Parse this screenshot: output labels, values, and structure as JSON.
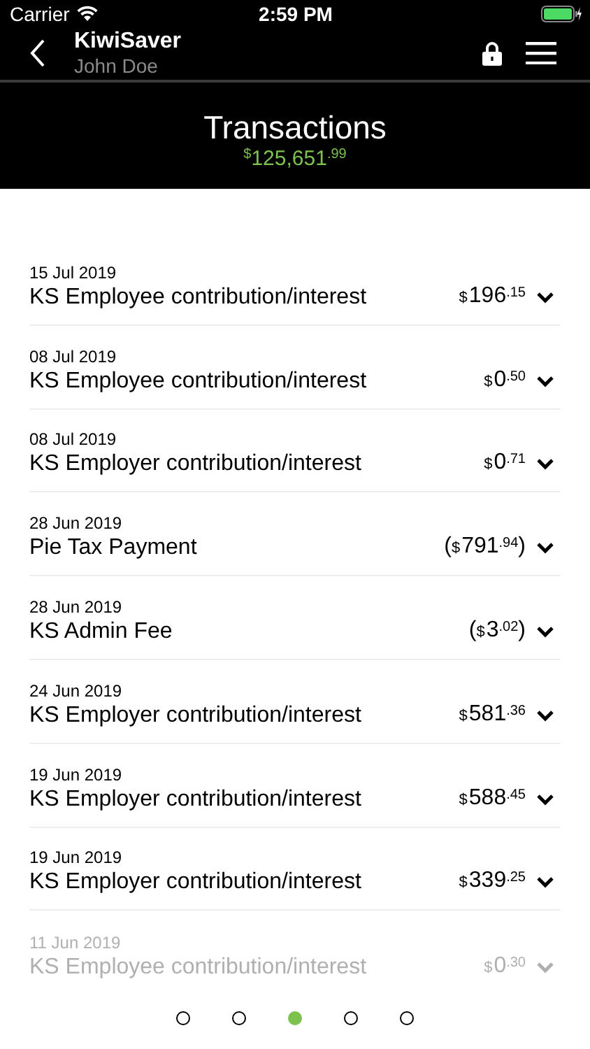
{
  "status_bar": {
    "carrier": "Carrier",
    "time": "2:59 PM"
  },
  "nav": {
    "title": "KiwiSaver",
    "subtitle": "John Doe"
  },
  "header": {
    "title": "Transactions",
    "balance": {
      "currency": "$",
      "whole": "125,651",
      "cents": ".99"
    }
  },
  "transactions": [
    {
      "date": "15 Jul 2019",
      "description": "KS Employee contribution/interest",
      "amount": {
        "currency": "$",
        "whole": "196",
        "cents": ".15"
      },
      "faded": false
    },
    {
      "date": "08 Jul 2019",
      "description": "KS Employee contribution/interest",
      "amount": {
        "currency": "$",
        "whole": "0",
        "cents": ".50"
      },
      "faded": false
    },
    {
      "date": "08 Jul 2019",
      "description": "KS Employer contribution/interest",
      "amount": {
        "currency": "$",
        "whole": "0",
        "cents": ".71"
      },
      "faded": false
    },
    {
      "date": "28 Jun 2019",
      "description": "Pie Tax Payment",
      "amount": {
        "open": "(",
        "currency": "$",
        "whole": "791",
        "cents": ".94",
        "close": ")"
      },
      "faded": false
    },
    {
      "date": "28 Jun 2019",
      "description": "KS Admin Fee",
      "amount": {
        "open": "(",
        "currency": "$",
        "whole": "3",
        "cents": ".02",
        "close": ")"
      },
      "faded": false
    },
    {
      "date": "24 Jun 2019",
      "description": "KS Employer contribution/interest",
      "amount": {
        "currency": "$",
        "whole": "581",
        "cents": ".36"
      },
      "faded": false
    },
    {
      "date": "19 Jun 2019",
      "description": "KS Employer contribution/interest",
      "amount": {
        "currency": "$",
        "whole": "588",
        "cents": ".45"
      },
      "faded": false
    },
    {
      "date": "19 Jun 2019",
      "description": "KS Employer contribution/interest",
      "amount": {
        "currency": "$",
        "whole": "339",
        "cents": ".25"
      },
      "faded": false
    },
    {
      "date": "11 Jun 2019",
      "description": "KS Employee contribution/interest",
      "amount": {
        "currency": "$",
        "whole": "0",
        "cents": ".30"
      },
      "faded": true
    }
  ],
  "pages": [
    {
      "selected": false
    },
    {
      "selected": false
    },
    {
      "selected": true
    },
    {
      "selected": false
    },
    {
      "selected": false
    }
  ]
}
